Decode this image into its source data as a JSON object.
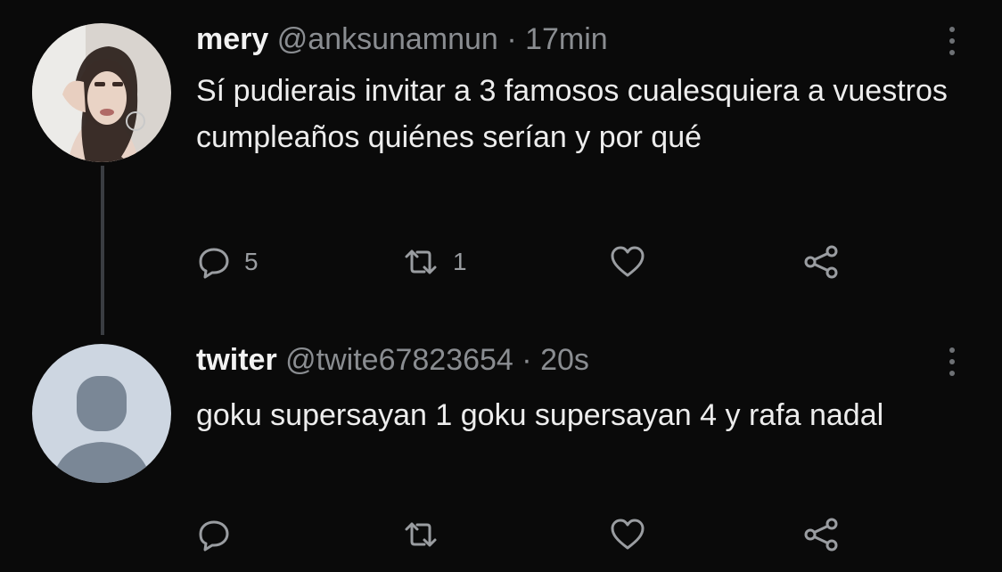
{
  "tweets": [
    {
      "name": "mery",
      "handle": "@anksunamnun",
      "time": "· 17min",
      "text": "Sí pudierais invitar a 3 famosos cualesquiera a vuestros cumpleaños quiénes serían y por qué",
      "replies": "5",
      "retweets": "1",
      "likes": "",
      "avatar": "profile-photo"
    },
    {
      "name": "twiter",
      "handle": "@twite67823654",
      "time": "· 20s",
      "text": "goku supersayan 1 goku supersayan 4 y rafa nadal",
      "replies": "",
      "retweets": "",
      "likes": "",
      "avatar": "default-avatar"
    }
  ],
  "icons": {
    "reply": "reply-icon",
    "retweet": "retweet-icon",
    "like": "heart-icon",
    "share": "share-icon",
    "more": "more-vertical-icon"
  },
  "colors": {
    "background": "#0a0a0a",
    "muted": "#8a8d91",
    "text": "#ededed"
  }
}
